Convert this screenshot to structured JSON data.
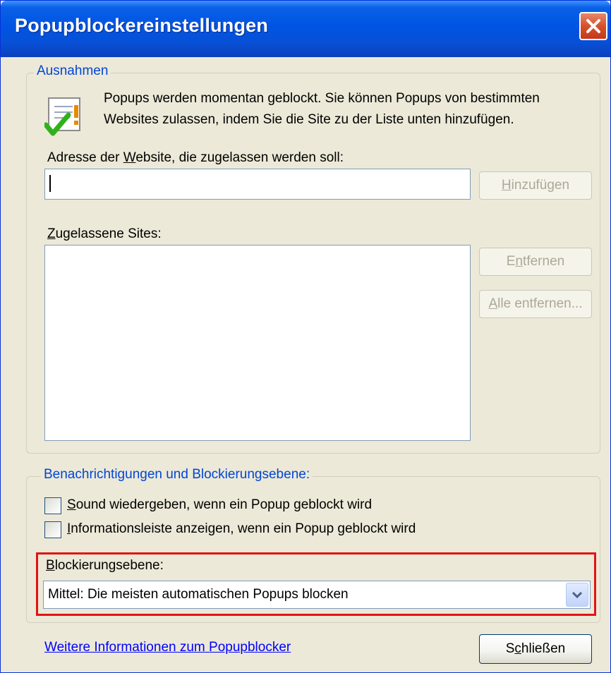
{
  "window": {
    "title": "Popupblockereinstellungen"
  },
  "exceptions": {
    "legend": "Ausnahmen",
    "info_line1": "Popups werden momentan geblockt. Sie können Popups von bestimmten",
    "info_line2": "Websites zulassen, indem Sie die Site zu der Liste unten hinzufügen.",
    "address_label": {
      "before": "Adresse der ",
      "accel": "W",
      "after": "ebsite, die zugelassen werden soll:"
    },
    "address_value": "",
    "add_button": {
      "accel": "H",
      "rest": "inzufügen"
    },
    "allowed_label": {
      "accel": "Z",
      "rest": "ugelassene Sites:"
    },
    "allowed_sites": [],
    "remove_button": {
      "before": "E",
      "accel": "n",
      "after": "tfernen"
    },
    "remove_all_button": {
      "accel": "A",
      "rest": "lle entfernen..."
    }
  },
  "notifications": {
    "legend": "Benachrichtigungen und Blockierungsebene:",
    "sound": {
      "accel": "S",
      "rest": "ound wiedergeben, wenn ein Popup geblockt wird",
      "checked": false
    },
    "infobar": {
      "accel": "I",
      "rest": "nformationsleiste anzeigen, wenn ein Popup geblockt wird",
      "checked": false
    },
    "level_label": {
      "accel": "B",
      "rest": "lockierungsebene:"
    },
    "level_value": "Mittel: Die meisten automatischen Popups blocken"
  },
  "footer": {
    "more_info_link": "Weitere Informationen zum Popupblocker",
    "close_button": {
      "before": "S",
      "accel": "c",
      "after": "hließen"
    }
  },
  "colors": {
    "highlight_border": "#e11414",
    "legend_text": "#0046d5",
    "titlebar": "#0054e3"
  },
  "icons": {
    "info": "checklist-warning-icon",
    "close": "close-x-icon",
    "dropdown": "chevron-down-icon"
  }
}
